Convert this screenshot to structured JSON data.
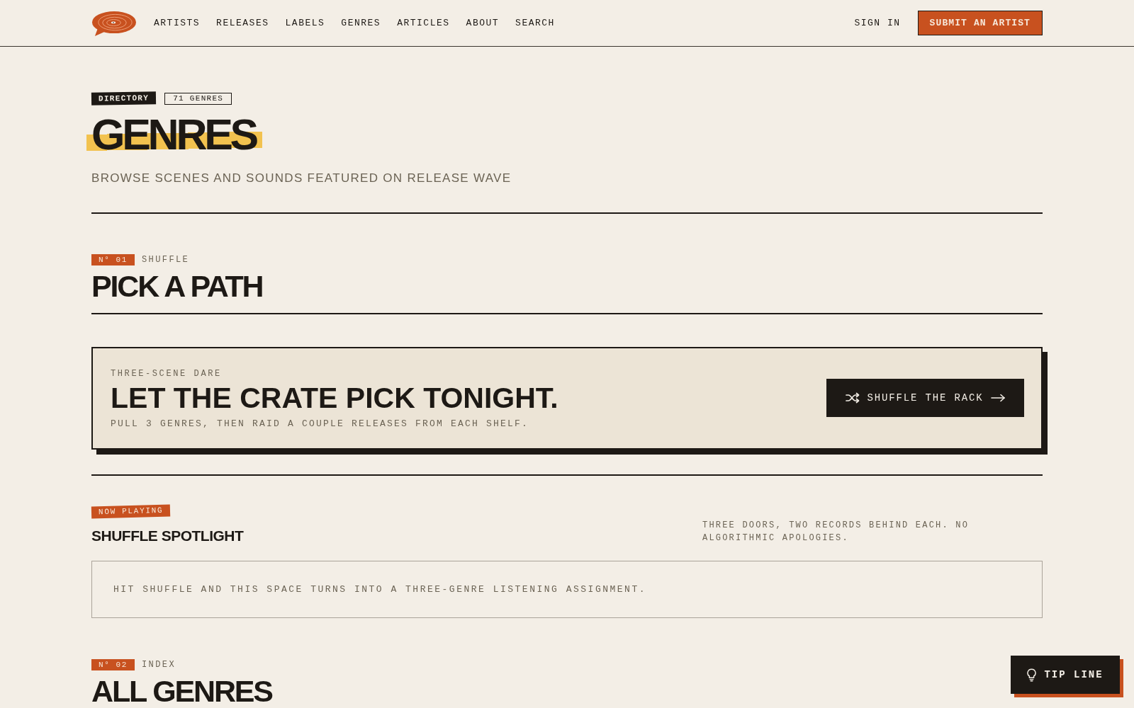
{
  "header": {
    "nav": [
      "ARTISTS",
      "RELEASES",
      "LABELS",
      "GENRES",
      "ARTICLES",
      "ABOUT",
      "SEARCH"
    ],
    "sign_in": "SIGN IN",
    "submit_button": "SUBMIT AN ARTIST"
  },
  "hero": {
    "category_tag": "DIRECTORY",
    "count_tag": "71 GENRES",
    "title": "GENRES",
    "subtitle": "BROWSE SCENES AND SOUNDS FEATURED ON RELEASE WAVE"
  },
  "shuffle_section": {
    "number": "N° 01",
    "label": "SHUFFLE",
    "title": "PICK A PATH",
    "dare_card": {
      "eyebrow": "THREE-SCENE DARE",
      "title": "LET THE CRATE PICK TONIGHT.",
      "text": "PULL 3 GENRES, THEN RAID A COUPLE RELEASES FROM EACH SHELF.",
      "button": "SHUFFLE THE RACK"
    },
    "spotlight": {
      "badge": "NOW PLAYING",
      "title": "SHUFFLE SPOTLIGHT",
      "note": "THREE DOORS, TWO RECORDS BEHIND EACH. NO ALGORITHMIC APOLOGIES.",
      "empty_message": "HIT SHUFFLE AND THIS SPACE TURNS INTO A THREE-GENRE LISTENING ASSIGNMENT."
    }
  },
  "index_section": {
    "number": "N° 02",
    "label": "INDEX",
    "title": "ALL GENRES"
  },
  "tip_line_button": "TIP LINE"
}
